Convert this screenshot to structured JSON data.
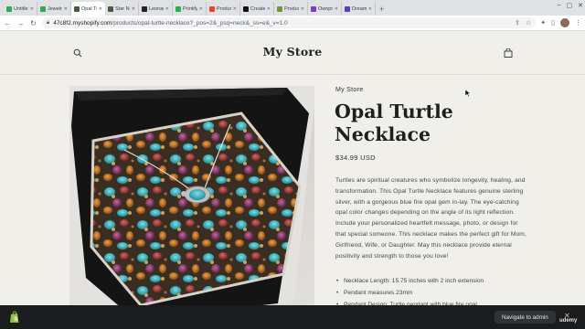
{
  "browser": {
    "tabs": [
      {
        "label": "Untitled",
        "color": "#34a853"
      },
      {
        "label": "Jewelry",
        "color": "#34a853"
      },
      {
        "label": "Opal Turtle",
        "color": "#4a5a40",
        "active": true
      },
      {
        "label": "Star Necklace",
        "color": "#4a5a40"
      },
      {
        "label": "Leonardo",
        "color": "#222222"
      },
      {
        "label": "Printify",
        "color": "#34a853"
      },
      {
        "label": "Products",
        "color": "#ea4335"
      },
      {
        "label": "Create",
        "color": "#111111"
      },
      {
        "label": "Products",
        "color": "#6f9a3a"
      },
      {
        "label": "Ownprint",
        "color": "#7b3fb8"
      },
      {
        "label": "Dreamshop",
        "color": "#5a3fb8"
      }
    ],
    "url_domain": "47c8f2.myshopify.com",
    "url_path": "/products/opal-turtle-necklace?_pos=2&_psq=neck&_ss=e&_v=1.0"
  },
  "store": {
    "title": "My Store"
  },
  "product": {
    "vendor": "My Store",
    "title": "Opal Turtle Necklace",
    "price": "$34.99 USD",
    "description": "Turtles are spiritual creatures  who symbolize longevity, healing, and transformation. This Opal Turtle Necklace features genuine sterling silver, with a gorgeous blue fire opal gem in-lay. The eye-catching opal color changes depending on the angle of its light reflection. Include your personalized heartfelt message, photo, or design for that special someone. This necklace makes the perfect gift for Mom, Girlfriend, Wife, or Daughter. May this necklace provide eternal positivity and strength to those you love!",
    "bullets": [
      "Necklace Length: 15.75 inches with 2 inch extension",
      "Pendant measures 23mm",
      "Pendant Design: Turtle pendant with blue fire opal"
    ]
  },
  "admin_bar": {
    "navigate_label": "Navigate to admin",
    "close_label": "✕"
  },
  "watermark": "udemy"
}
